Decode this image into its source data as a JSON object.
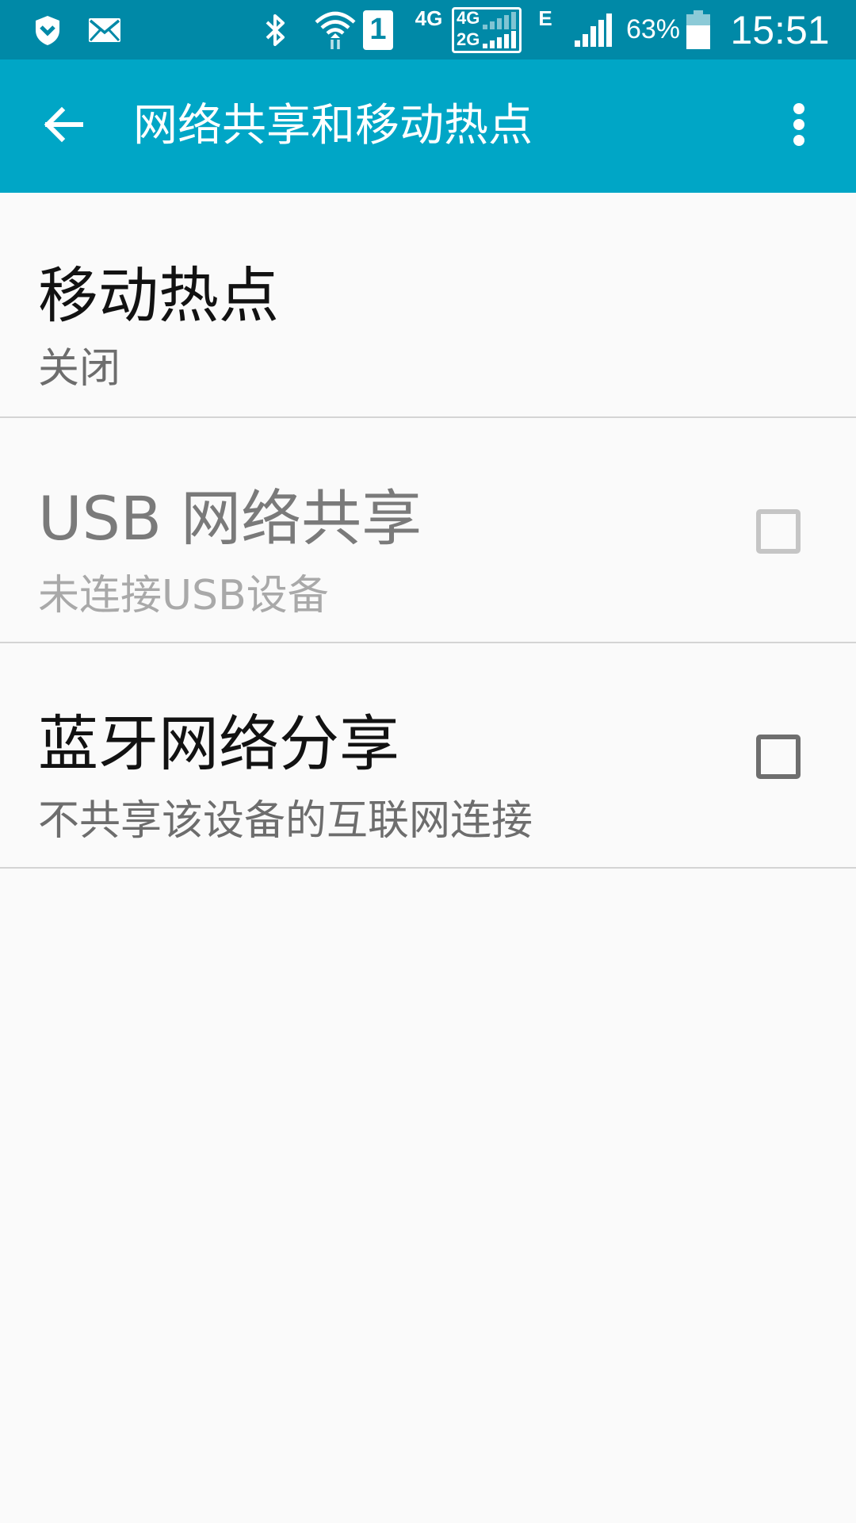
{
  "status_bar": {
    "network_4g": "4G",
    "sim_4g": "4G",
    "sim_2g": "2G",
    "sim_slot": "1",
    "edge": "E",
    "battery_percent": "63%",
    "time": "15:51",
    "icons": [
      "shield-icon",
      "mail-icon",
      "bluetooth-icon",
      "wifi-icon",
      "signal-icon",
      "battery-icon"
    ]
  },
  "app_bar": {
    "title": "网络共享和移动热点",
    "back_icon": "arrow-back-icon",
    "more_icon": "more-vert-icon",
    "color": "#00a6c6",
    "status_color": "#0089a7"
  },
  "settings": {
    "items": [
      {
        "title": "移动热点",
        "subtitle": "关闭"
      },
      {
        "title": "USB 网络共享",
        "subtitle": "未连接USB设备",
        "checked": false,
        "enabled": false
      },
      {
        "title": "蓝牙网络分享",
        "subtitle": "不共享该设备的互联网连接",
        "checked": false,
        "enabled": true
      }
    ]
  }
}
